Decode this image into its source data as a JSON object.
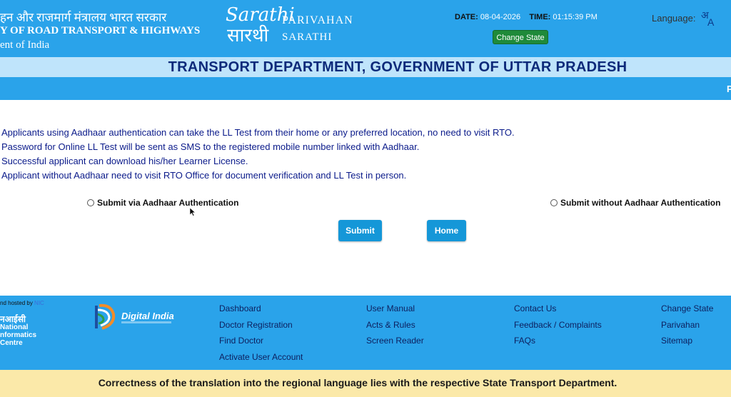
{
  "header": {
    "ministry_hindi": "हन और राजमार्ग मंत्रालय भारत सरकार",
    "ministry_english_line1": "Y OF ROAD TRANSPORT & HIGHWAYS",
    "ministry_english_line2": "ent of India",
    "logo_script_top": "Sarathi",
    "logo_script_bottom": "सारथी",
    "logo_title": "PARIVAHAN",
    "logo_subtitle": "SARATHI",
    "date_label": "DATE:",
    "date_value": "08-04-2026",
    "time_label": "TIME:",
    "time_value": "01:15:39 PM",
    "change_state_label": "Change State",
    "language_label": "Language:",
    "language_icon_hindi": "अ",
    "language_icon_english": "A"
  },
  "title": "TRANSPORT DEPARTMENT, GOVERNMENT OF UTTAR PRADESH",
  "marquee_text": "P",
  "info": [
    "Applicants using Aadhaar authentication can take the LL Test from their home or any preferred location, no need to visit RTO.",
    "Password for Online LL Test will be sent as SMS to the registered mobile number linked with Aadhaar.",
    "Successful applicant can download his/her Learner License.",
    "Applicant without Aadhaar need to visit RTO Office for document verification and LL Test in person."
  ],
  "options": {
    "aadhaar_label": "Submit via Aadhaar Authentication",
    "without_aadhaar_label": "Submit without Aadhaar Authentication"
  },
  "buttons": {
    "submit_label": "Submit",
    "home_label": "Home"
  },
  "footer": {
    "hosted_prefix": "nd hosted by",
    "hosted_org": "NIC",
    "nic_hindi": "नआईसी",
    "nic_line1": "National",
    "nic_line2": "nformatics",
    "nic_line3": "Centre",
    "digital_india": "Digital India",
    "columns": [
      [
        "Dashboard",
        "Doctor Registration",
        "Find Doctor",
        "Activate User Account"
      ],
      [
        "User Manual",
        "Acts & Rules",
        "Screen Reader"
      ],
      [
        "Contact Us",
        "Feedback / Complaints",
        "FAQs"
      ],
      [
        "Change State",
        "Parivahan",
        "Sitemap"
      ]
    ]
  },
  "disclaimer": "Correctness of the translation into the regional language lies with the respective State Transport Department.",
  "colors": {
    "header_blue": "#2aa3ea",
    "title_strip": "#bfe4fb",
    "title_text": "#0d2a7a",
    "button_blue": "#1597d8",
    "change_state_green": "#1f8a3a",
    "disclaimer_bg": "#fbe9a9"
  }
}
